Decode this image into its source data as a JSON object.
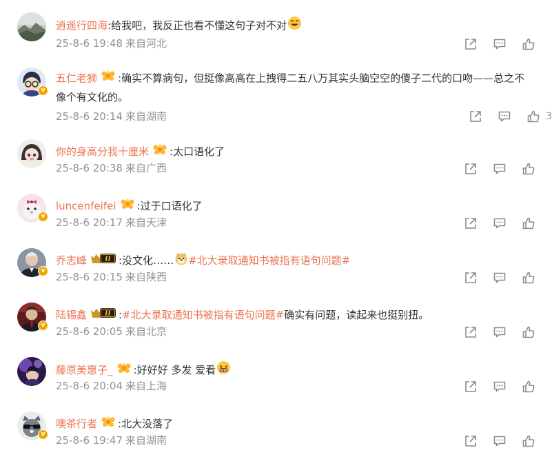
{
  "colors": {
    "username": "#eb7350",
    "text": "#333333",
    "meta": "#939393",
    "icon": "#8a8a8a"
  },
  "comments": [
    {
      "username": "逍遥行四海",
      "avatar": "landscape",
      "verified": false,
      "badge": null,
      "segments": [
        {
          "type": "text",
          "value": ":给我吧，我反正也看不懂这句子对不对"
        }
      ],
      "emoji": "laugh-cry-emoji",
      "date": "25-8-6 19:48",
      "location": "来自河北",
      "likes": ""
    },
    {
      "username": "五仁老狮",
      "avatar": "cartoon-detective",
      "verified": true,
      "badge": "flower",
      "segments": [
        {
          "type": "text",
          "value": ":确实不算病句，但挺像高高在上拽得二五八万其实头脑空空的傻子二代的口吻——总之不像个有文化的。"
        }
      ],
      "emoji": null,
      "date": "25-8-6 20:14",
      "location": "来自湖南",
      "likes": "3"
    },
    {
      "username": "你的身高分我十厘米",
      "avatar": "cartoon-girl",
      "verified": false,
      "badge": "flower",
      "segments": [
        {
          "type": "text",
          "value": ":太口语化了"
        }
      ],
      "emoji": null,
      "date": "25-8-6 20:38",
      "location": "来自广西",
      "likes": ""
    },
    {
      "username": "luncenfeifei",
      "avatar": "cat-bow",
      "verified": true,
      "badge": "flower",
      "segments": [
        {
          "type": "text",
          "value": ":过于口语化了"
        }
      ],
      "emoji": null,
      "date": "25-8-6 20:17",
      "location": "来自天津",
      "likes": ""
    },
    {
      "username": "乔志峰",
      "avatar": "man-portrait",
      "verified": true,
      "badge": "crown",
      "badge_text": "II",
      "segments": [
        {
          "type": "text",
          "value": ":没文化……"
        },
        {
          "type": "emoji",
          "value": "doge-emoji"
        },
        {
          "type": "topic",
          "value": "#北大录取通知书被指有语句问题#"
        }
      ],
      "emoji": null,
      "date": "25-8-6 20:15",
      "location": "来自陕西",
      "likes": ""
    },
    {
      "username": "陆锡鑫",
      "avatar": "man-suit",
      "verified": true,
      "badge": "crown",
      "badge_text": "II",
      "segments": [
        {
          "type": "text",
          "value": ":"
        },
        {
          "type": "topic",
          "value": "#北大录取通知书被指有语句问题#"
        },
        {
          "type": "text",
          "value": " 确实有问题，读起来也挺别扭。"
        }
      ],
      "emoji": null,
      "date": "25-8-6 20:05",
      "location": "来自北京",
      "likes": ""
    },
    {
      "username": "藤原美惠子_",
      "avatar": "purple-light",
      "verified": false,
      "badge": "flower",
      "segments": [
        {
          "type": "text",
          "value": ":好好好 多发 爱看"
        }
      ],
      "emoji": "grin-emoji",
      "date": "25-8-6 20:04",
      "location": "来自上海",
      "likes": ""
    },
    {
      "username": "噢茶行者",
      "avatar": "cat-sunglasses",
      "verified": true,
      "badge": "flower",
      "segments": [
        {
          "type": "text",
          "value": ":北大没落了"
        }
      ],
      "emoji": null,
      "date": "25-8-6 19:47",
      "location": "来自湖南",
      "likes": ""
    }
  ]
}
